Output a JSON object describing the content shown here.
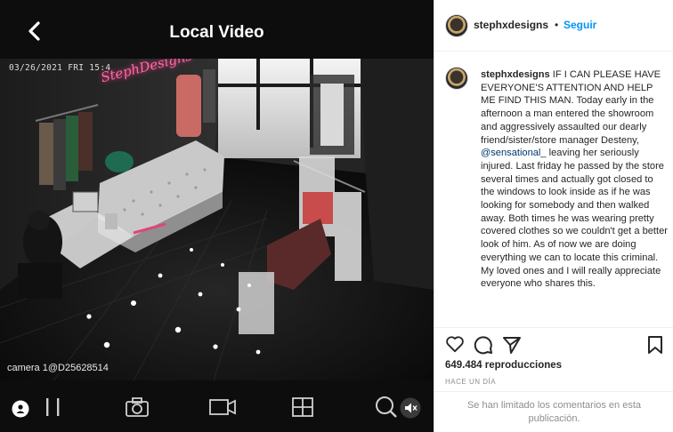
{
  "video": {
    "title": "Local Video",
    "timestamp": "03/26/2021 FRI 15:4",
    "camera_label": "camera 1@D25628514",
    "neon_sign": "StephDesigns"
  },
  "controls": [
    "person-icon",
    "pause-icon",
    "camera-icon",
    "record-icon",
    "grid-icon",
    "zoom-icon",
    "mute-icon"
  ],
  "post": {
    "username": "stephxdesigns",
    "dot": "•",
    "follow_label": "Seguir",
    "caption_user": "stephxdesigns",
    "caption_part1": " IF I CAN PLEASE HAVE EVERYONE'S ATTENTION AND HELP ME FIND THIS MAN. Today early in the afternoon a man entered the showroom and aggressively assaulted our dearly friend/sister/store manager Desteny, ",
    "mention": "@sensational_",
    "caption_part2": " leaving her seriously injured. Last friday he passed by the store several times and actually got closed to the windows to look inside as if he was looking for somebody and then walked away. Both times he was wearing pretty covered clothes so we couldn't get a better look of him. As of now we are doing everything we can to locate this criminal. My loved ones and I will really appreciate everyone who shares this.",
    "views": "649.484 reproducciones",
    "date": "HACE UN DÍA",
    "comments_limited": "Se han limitado los comentarios en esta publicación."
  },
  "colors": {
    "accent": "#0095f6",
    "mention": "#00376b",
    "video_bg": "#0d0d0d"
  }
}
